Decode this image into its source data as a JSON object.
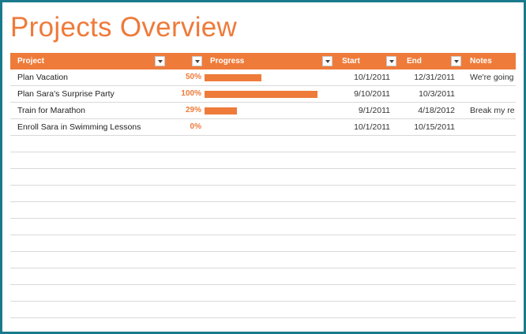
{
  "title": "Projects Overview",
  "accent_color": "#ef7b3a",
  "frame_color": "#1a7a8c",
  "columns": {
    "project": "Project",
    "progress": "Progress",
    "start": "Start",
    "end": "End",
    "notes": "Notes"
  },
  "rows": [
    {
      "project": "Plan Vacation",
      "percent": "50%",
      "progress": 0.5,
      "start": "10/1/2011",
      "end": "12/31/2011",
      "notes": "We're going"
    },
    {
      "project": "Plan Sara's Surprise Party",
      "percent": "100%",
      "progress": 1.0,
      "start": "9/10/2011",
      "end": "10/3/2011",
      "notes": ""
    },
    {
      "project": "Train for Marathon",
      "percent": "29%",
      "progress": 0.29,
      "start": "9/1/2011",
      "end": "4/18/2012",
      "notes": "Break my re"
    },
    {
      "project": "Enroll Sara in Swimming Lessons",
      "percent": "0%",
      "progress": 0.0,
      "start": "10/1/2011",
      "end": "10/15/2011",
      "notes": ""
    },
    {
      "project": "",
      "percent": "",
      "progress": null,
      "start": "",
      "end": "",
      "notes": ""
    },
    {
      "project": "",
      "percent": "",
      "progress": null,
      "start": "",
      "end": "",
      "notes": ""
    },
    {
      "project": "",
      "percent": "",
      "progress": null,
      "start": "",
      "end": "",
      "notes": ""
    },
    {
      "project": "",
      "percent": "",
      "progress": null,
      "start": "",
      "end": "",
      "notes": ""
    },
    {
      "project": "",
      "percent": "",
      "progress": null,
      "start": "",
      "end": "",
      "notes": ""
    },
    {
      "project": "",
      "percent": "",
      "progress": null,
      "start": "",
      "end": "",
      "notes": ""
    },
    {
      "project": "",
      "percent": "",
      "progress": null,
      "start": "",
      "end": "",
      "notes": ""
    },
    {
      "project": "",
      "percent": "",
      "progress": null,
      "start": "",
      "end": "",
      "notes": ""
    },
    {
      "project": "",
      "percent": "",
      "progress": null,
      "start": "",
      "end": "",
      "notes": ""
    },
    {
      "project": "",
      "percent": "",
      "progress": null,
      "start": "",
      "end": "",
      "notes": ""
    },
    {
      "project": "",
      "percent": "",
      "progress": null,
      "start": "",
      "end": "",
      "notes": ""
    },
    {
      "project": "",
      "percent": "",
      "progress": null,
      "start": "",
      "end": "",
      "notes": ""
    }
  ]
}
